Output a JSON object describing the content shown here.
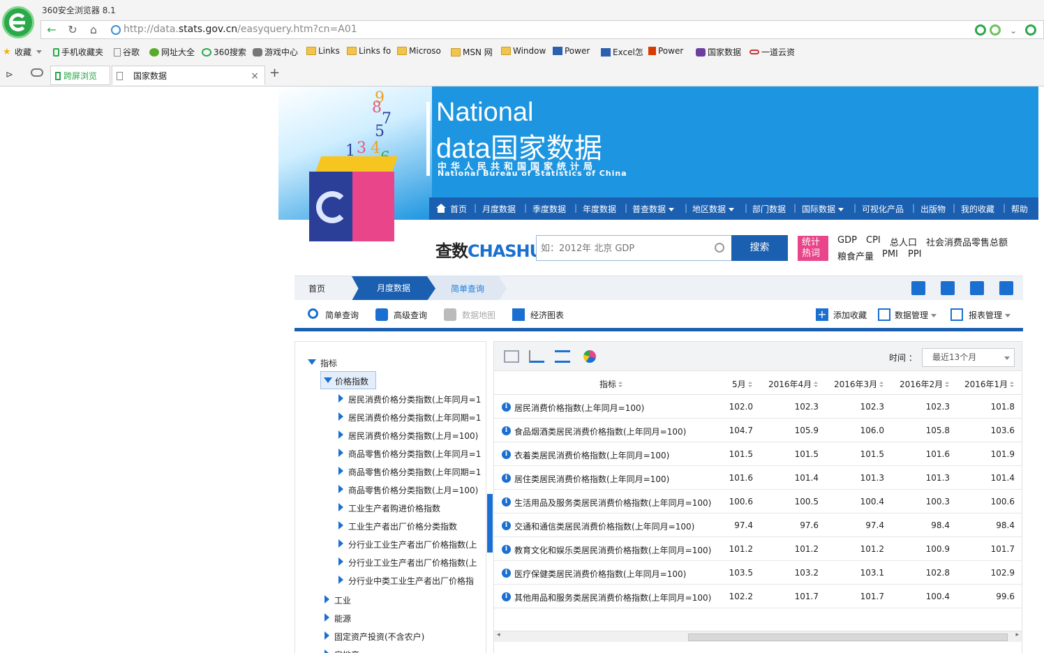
{
  "browser": {
    "app_title": "360安全浏览器 8.1",
    "url_prefix": "http://data.",
    "url_host": "stats.gov.cn",
    "url_path": "/easyquery.htm?cn=A01",
    "bookmarks": [
      "收藏",
      "手机收藏夹",
      "谷歌",
      "网址大全",
      "360搜索",
      "游戏中心",
      "Links",
      "Links fo",
      "Microso",
      "MSN 网",
      "Window",
      "Power",
      "Excel怎",
      "Power",
      "国家数据",
      "一道云资"
    ],
    "tabs": {
      "cross_screen": "跨屏浏览",
      "current": "国家数据"
    }
  },
  "site": {
    "brand_national": "National",
    "brand_data": "data国家数据",
    "brand_cn": "中华人民共和国国家统计局",
    "brand_en": "National Bureau of Statistics of China",
    "nav": [
      "首页",
      "月度数据",
      "季度数据",
      "年度数据",
      "普查数据",
      "地区数据",
      "部门数据",
      "国际数据",
      "可视化产品",
      "出版物",
      "我的收藏",
      "帮助"
    ],
    "search": {
      "logo_cn": "查数",
      "logo_en": "CHASHU",
      "placeholder": "如：2012年 北京 GDP",
      "button": "搜索",
      "hot_badge": "统计热词",
      "hot_words": [
        "GDP",
        "CPI",
        "总人口",
        "社会消费品零售总额",
        "粮食产量",
        "PMI",
        "PPI"
      ]
    },
    "breadcrumb": {
      "home": "首页",
      "month": "月度数据",
      "simple": "简单查询"
    },
    "toolbar": {
      "simple": "简单查询",
      "advanced": "高级查询",
      "map": "数据地图",
      "chart": "经济图表",
      "add_fav": "添加收藏",
      "data_mgmt": "数据管理",
      "report_mgmt": "报表管理"
    }
  },
  "tree": {
    "root": "指标",
    "selected": "价格指数",
    "children": [
      "居民消费价格分类指数(上年同月=1",
      "居民消费价格分类指数(上年同期=1",
      "居民消费价格分类指数(上月=100)",
      "商品零售价格分类指数(上年同月=1",
      "商品零售价格分类指数(上年同期=1",
      "商品零售价格分类指数(上月=100)",
      "工业生产者购进价格指数",
      "工业生产者出厂价格分类指数",
      "分行业工业生产者出厂价格指数(上",
      "分行业工业生产者出厂价格指数(上",
      "分行业中类工业生产者出厂价格指"
    ],
    "siblings": [
      "工业",
      "能源",
      "固定资产投资(不含农户)",
      "房地产"
    ]
  },
  "table": {
    "time_label": "时间 ：",
    "time_value": "最近13个月",
    "headers": [
      "指标",
      "5月",
      "2016年4月",
      "2016年3月",
      "2016年2月",
      "2016年1月"
    ],
    "rows": [
      {
        "name": "居民消费价格指数(上年同月=100)",
        "values": [
          "102.0",
          "102.3",
          "102.3",
          "102.3",
          "101.8"
        ]
      },
      {
        "name": "食品烟酒类居民消费价格指数(上年同月=100)",
        "values": [
          "104.7",
          "105.9",
          "106.0",
          "105.8",
          "103.6"
        ]
      },
      {
        "name": "衣着类居民消费价格指数(上年同月=100)",
        "values": [
          "101.5",
          "101.5",
          "101.5",
          "101.6",
          "101.9"
        ]
      },
      {
        "name": "居住类居民消费价格指数(上年同月=100)",
        "values": [
          "101.6",
          "101.4",
          "101.3",
          "101.3",
          "101.4"
        ]
      },
      {
        "name": "生活用品及服务类居民消费价格指数(上年同月=100)",
        "values": [
          "100.6",
          "100.5",
          "100.4",
          "100.3",
          "100.6"
        ]
      },
      {
        "name": "交通和通信类居民消费价格指数(上年同月=100)",
        "values": [
          "97.4",
          "97.6",
          "97.4",
          "98.4",
          "98.4"
        ]
      },
      {
        "name": "教育文化和娱乐类居民消费价格指数(上年同月=100)",
        "values": [
          "101.2",
          "101.2",
          "101.2",
          "100.9",
          "101.7"
        ]
      },
      {
        "name": "医疗保健类居民消费价格指数(上年同月=100)",
        "values": [
          "103.5",
          "103.2",
          "103.1",
          "102.8",
          "102.9"
        ]
      },
      {
        "name": "其他用品和服务类居民消费价格指数(上年同月=100)",
        "values": [
          "102.2",
          "101.7",
          "101.7",
          "100.4",
          "99.6"
        ]
      }
    ]
  },
  "colors": {
    "brand_blue": "#1d95e0",
    "nav_blue": "#1a5fb0",
    "hot_pink": "#e8458a"
  }
}
